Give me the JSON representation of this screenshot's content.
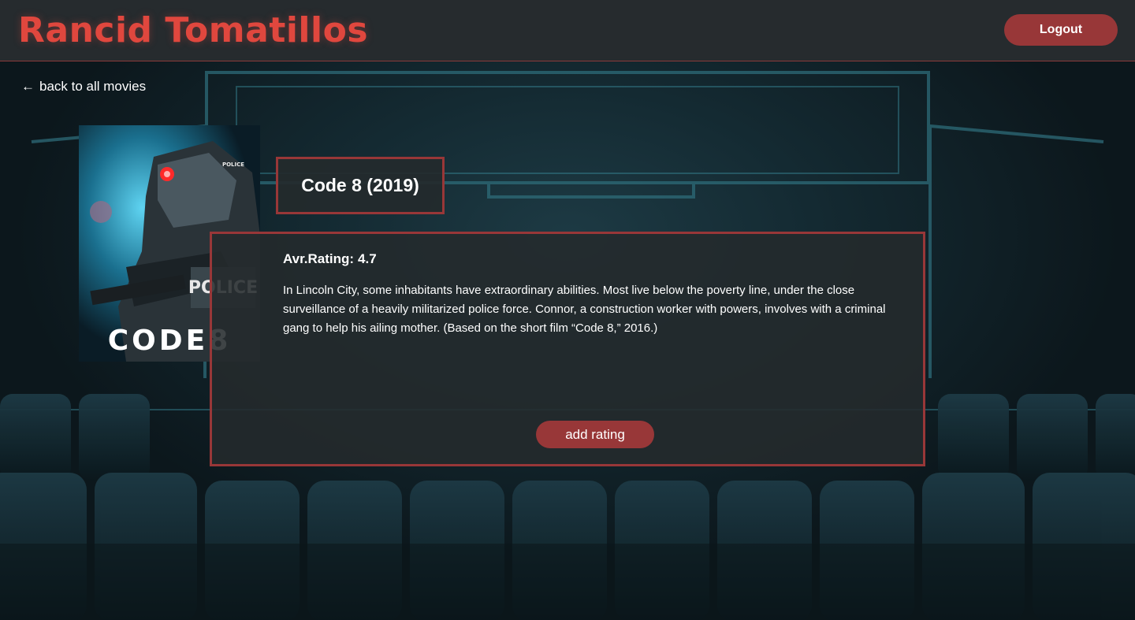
{
  "header": {
    "brand": "Rancid Tomatillos",
    "logout_label": "Logout"
  },
  "nav": {
    "back_arrow": "←",
    "back_label": "back to all movies"
  },
  "movie": {
    "poster_text": "CODE8",
    "poster_badge_1": "POLICE",
    "poster_badge_2": "POLICE",
    "title": "Code 8 (2019)",
    "rating_label": "Avr.Rating:",
    "rating_value": "4.7",
    "overview": "In Lincoln City, some inhabitants have extraordinary abilities. Most live below the poverty line, under the close surveillance of a heavily militarized police force. Connor, a construction worker with powers, involves with a criminal gang to help his ailing mother. (Based on the short film “Code 8,” 2016.)",
    "add_rating_label": "add rating"
  },
  "colors": {
    "brand": "#e0473e",
    "accent": "#983738",
    "header_bg": "#262b2e",
    "panel_bg": "#242a2c"
  }
}
